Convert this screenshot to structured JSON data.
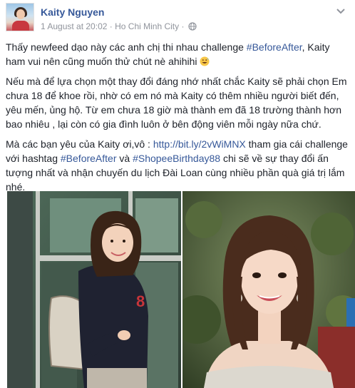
{
  "post": {
    "author": "Kaity Nguyen",
    "timestamp": "1 August at 20:02",
    "separator": "·",
    "location": "Ho Chi Minh City",
    "paragraph1": {
      "before": "Thấy newfeed dạo này các anh chị thi nhau challenge ",
      "hashtag": "#BeforeAfter",
      "after": ", Kaity ham vui nên cũng muốn thử chút nè ahihihi "
    },
    "paragraph2": "Nếu mà để lựa chọn một thay đổi đáng nhớ nhất chắc Kaity sẽ phải chọn Em chưa 18 để khoe rồi, nhờ có em nó mà Kaity có thêm nhiều người biết đến, yêu mến, ủng hộ. Từ em chưa 18 giờ mà thành em đã 18 trường thành hơn bao nhiêu , lại còn có gia đình luôn ở bên động viên mỗi ngày nữa chứ.",
    "paragraph3": {
      "before": "Mà các bạn yêu của Kaity ơi,vô : ",
      "link": "http://bit.ly/2vWiMNX",
      "middle": " tham gia cái challenge với hashtag ",
      "hashtag1": "#BeforeAfter",
      "and": " và ",
      "hashtag2": "#ShopeeBirthday88",
      "after": " chi sẽ về sự thay đổi ấn tượng nhất và nhận chuyến du lịch Đài Loan cùng nhiều phần quà giá trị lắm nhé."
    }
  },
  "icons": {
    "globe": "globe-icon",
    "chevron": "chevron-down-icon",
    "emoji": "grinning-sweat-emoji-icon"
  },
  "colors": {
    "author": "#365899",
    "link": "#365899",
    "meta": "#90949c",
    "text": "#1d2129"
  }
}
